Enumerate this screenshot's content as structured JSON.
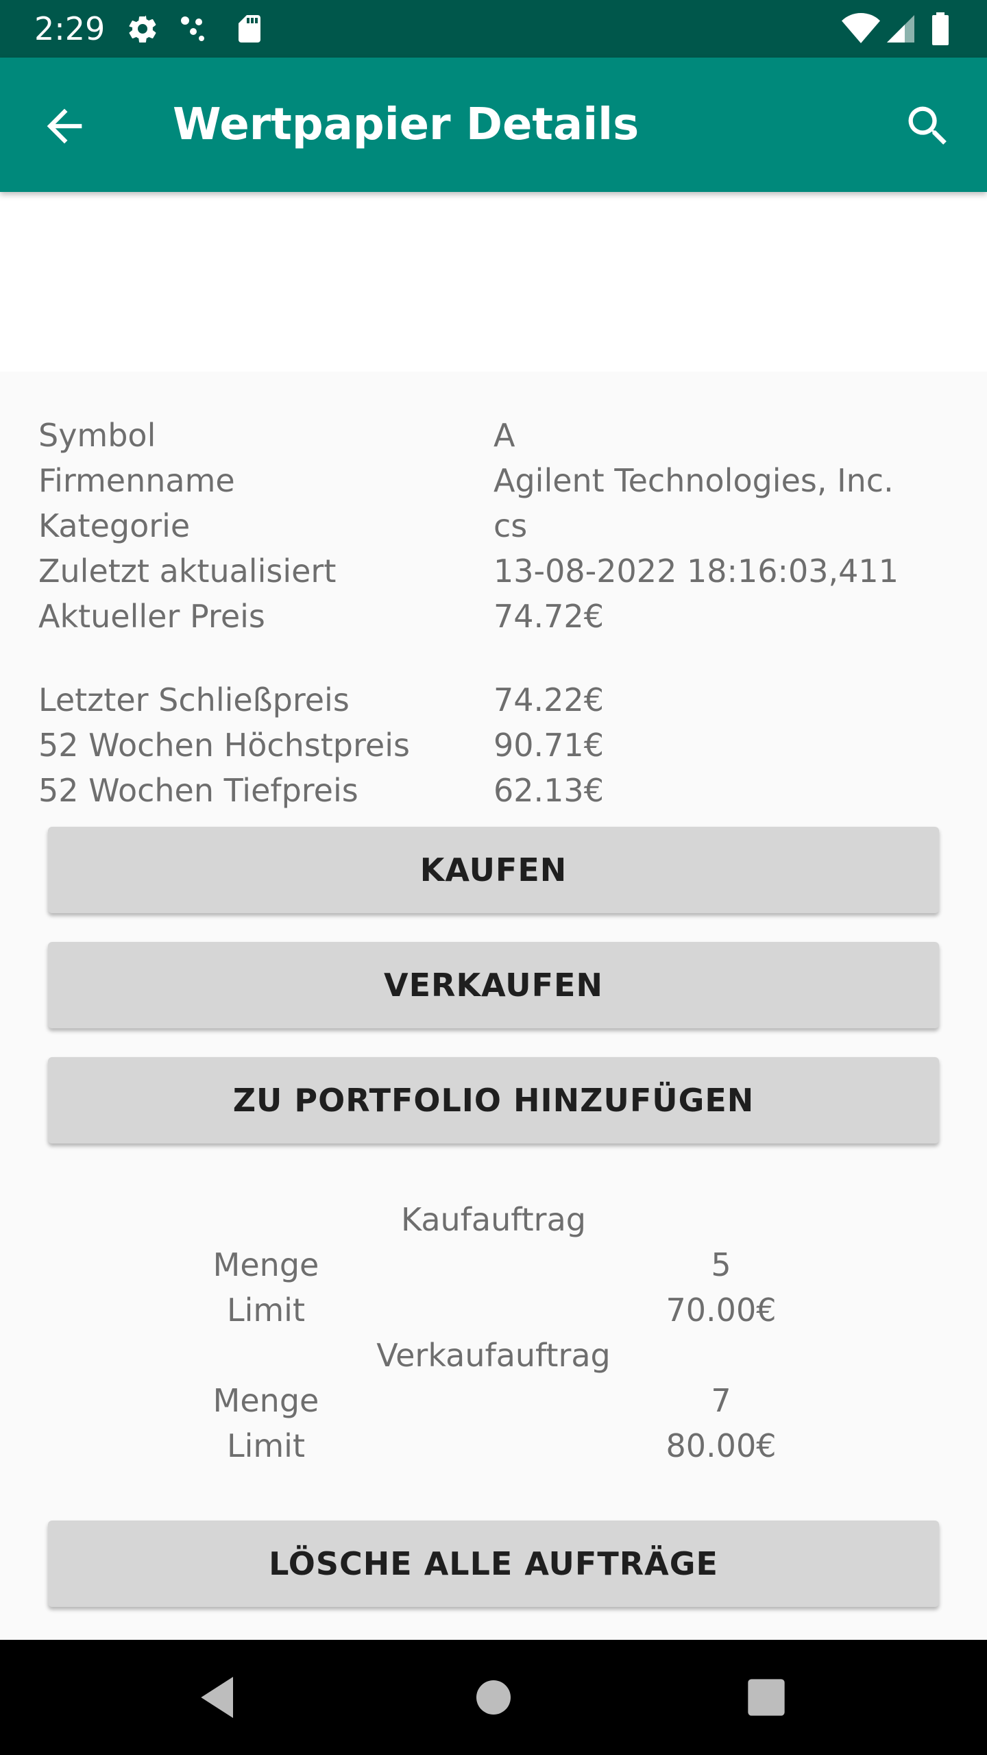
{
  "status_bar": {
    "time": "2:29",
    "icons": [
      "settings-icon",
      "network-dots-icon",
      "sd-card-icon",
      "wifi-icon",
      "cell-signal-icon",
      "battery-icon"
    ]
  },
  "app_bar": {
    "title": "Wertpapier Details",
    "back_icon": "arrow-back-icon",
    "search_icon": "search-icon",
    "color": "#00897b"
  },
  "details": [
    {
      "label": "Symbol",
      "value": "A"
    },
    {
      "label": "Firmenname",
      "value": "Agilent Technologies, Inc."
    },
    {
      "label": "Kategorie",
      "value": "cs"
    },
    {
      "label": "Zuletzt aktualisiert",
      "value": "13-08-2022 18:16:03,411"
    },
    {
      "label": "Aktueller Preis",
      "value": "74.72€"
    },
    {
      "label": "Letzter Schließpreis",
      "value": "74.22€"
    },
    {
      "label": "52 Wochen Höchstpreis",
      "value": "90.71€"
    },
    {
      "label": "52 Wochen Tiefpreis",
      "value": "62.13€"
    }
  ],
  "buttons": {
    "buy": "KAUFEN",
    "sell": "VERKAUFEN",
    "add_portfolio": "ZU PORTFOLIO HINZUFÜGEN",
    "delete_orders": "LÖSCHE ALLE AUFTRÄGE"
  },
  "orders": {
    "buy": {
      "heading": "Kaufauftrag",
      "quantity_label": "Menge",
      "quantity": "5",
      "limit_label": "Limit",
      "limit": "70.00€"
    },
    "sell": {
      "heading": "Verkaufauftrag",
      "quantity_label": "Menge",
      "quantity": "7",
      "limit_label": "Limit",
      "limit": "80.00€"
    }
  },
  "nav_bar": {
    "icons": [
      "back-triangle-icon",
      "home-circle-icon",
      "recents-square-icon"
    ]
  }
}
